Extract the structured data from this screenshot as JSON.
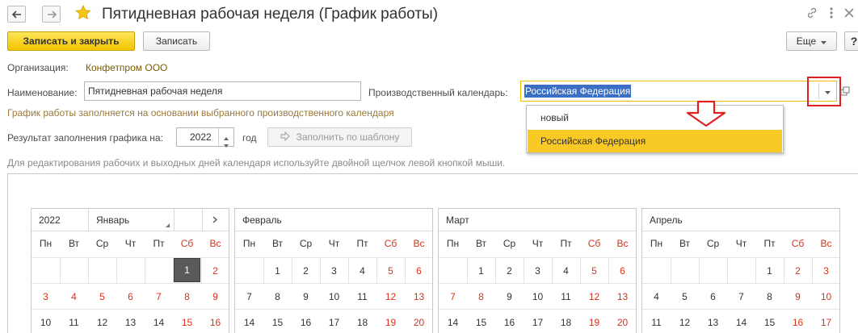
{
  "header": {
    "title": "Пятидневная рабочая неделя (График работы)"
  },
  "toolbar": {
    "save_close_label": "Записать и закрыть",
    "save_label": "Записать",
    "more_label": "Еще",
    "help_label": "?"
  },
  "form": {
    "org_label": "Организация:",
    "org_value": "Конфетпром ООО",
    "name_label": "Наименование:",
    "name_value": "Пятидневная рабочая неделя",
    "calendar_label": "Производственный календарь:",
    "calendar_value": "Российская Федерация",
    "hint_text": "График работы заполняется на основании выбранного производственного календаря",
    "result_label": "Результат заполнения графика на:",
    "year_value": "2022",
    "year_suffix": "год",
    "fill_button_label": "Заполнить по шаблону",
    "edit_hint": "Для редактирования рабочих и выходных дней календаря используйте двойной щелчок левой кнопкой мыши."
  },
  "dropdown": {
    "options": [
      "новый",
      "Российская Федерация"
    ],
    "selected_index": 1
  },
  "calendar": {
    "year": "2022",
    "weekdays": [
      "Пн",
      "Вт",
      "Ср",
      "Чт",
      "Пт",
      "Сб",
      "Вс"
    ],
    "weekend_color": "#d6331e",
    "months": [
      {
        "name": "Январь",
        "rows": [
          [
            "",
            "",
            "",
            "",
            "",
            "1",
            "2"
          ],
          [
            "3",
            "4",
            "5",
            "6",
            "7",
            "8",
            "9"
          ],
          [
            "10",
            "11",
            "12",
            "13",
            "14",
            "15",
            "16"
          ]
        ],
        "red": [
          [
            0,
            5
          ],
          [
            0,
            6
          ],
          [
            1,
            0
          ],
          [
            1,
            1
          ],
          [
            1,
            2
          ],
          [
            1,
            3
          ],
          [
            1,
            4
          ],
          [
            1,
            5
          ],
          [
            1,
            6
          ],
          [
            2,
            5
          ],
          [
            2,
            6
          ]
        ],
        "today": [
          0,
          5
        ]
      },
      {
        "name": "Февраль",
        "rows": [
          [
            "",
            "1",
            "2",
            "3",
            "4",
            "5",
            "6"
          ],
          [
            "7",
            "8",
            "9",
            "10",
            "11",
            "12",
            "13"
          ],
          [
            "14",
            "15",
            "16",
            "17",
            "18",
            "19",
            "20"
          ]
        ],
        "red": [
          [
            0,
            5
          ],
          [
            0,
            6
          ],
          [
            1,
            5
          ],
          [
            1,
            6
          ],
          [
            2,
            5
          ],
          [
            2,
            6
          ]
        ]
      },
      {
        "name": "Март",
        "rows": [
          [
            "",
            "1",
            "2",
            "3",
            "4",
            "5",
            "6"
          ],
          [
            "7",
            "8",
            "9",
            "10",
            "11",
            "12",
            "13"
          ],
          [
            "14",
            "15",
            "16",
            "17",
            "18",
            "19",
            "20"
          ]
        ],
        "red": [
          [
            0,
            5
          ],
          [
            0,
            6
          ],
          [
            1,
            0
          ],
          [
            1,
            1
          ],
          [
            1,
            5
          ],
          [
            1,
            6
          ],
          [
            2,
            5
          ],
          [
            2,
            6
          ]
        ]
      },
      {
        "name": "Апрель",
        "rows": [
          [
            "",
            "",
            "",
            "",
            "1",
            "2",
            "3"
          ],
          [
            "4",
            "5",
            "6",
            "7",
            "8",
            "9",
            "10"
          ],
          [
            "11",
            "12",
            "13",
            "14",
            "15",
            "16",
            "17"
          ]
        ],
        "red": [
          [
            0,
            5
          ],
          [
            0,
            6
          ],
          [
            1,
            5
          ],
          [
            1,
            6
          ],
          [
            2,
            5
          ],
          [
            2,
            6
          ]
        ]
      }
    ]
  },
  "colors": {
    "primary_button": "#f3c400",
    "dropdown_selected": "#f9c926",
    "highlight_border": "#e02020",
    "arrow": "#e02020",
    "selection_bg": "#3a6fc4"
  },
  "icons": {
    "back": "back-arrow-icon",
    "forward": "forward-arrow-icon",
    "favorite": "star-icon",
    "link": "link-icon",
    "more": "more-vertical-icon",
    "close": "close-icon",
    "open": "open-window-icon",
    "fill": "fill-icon"
  }
}
